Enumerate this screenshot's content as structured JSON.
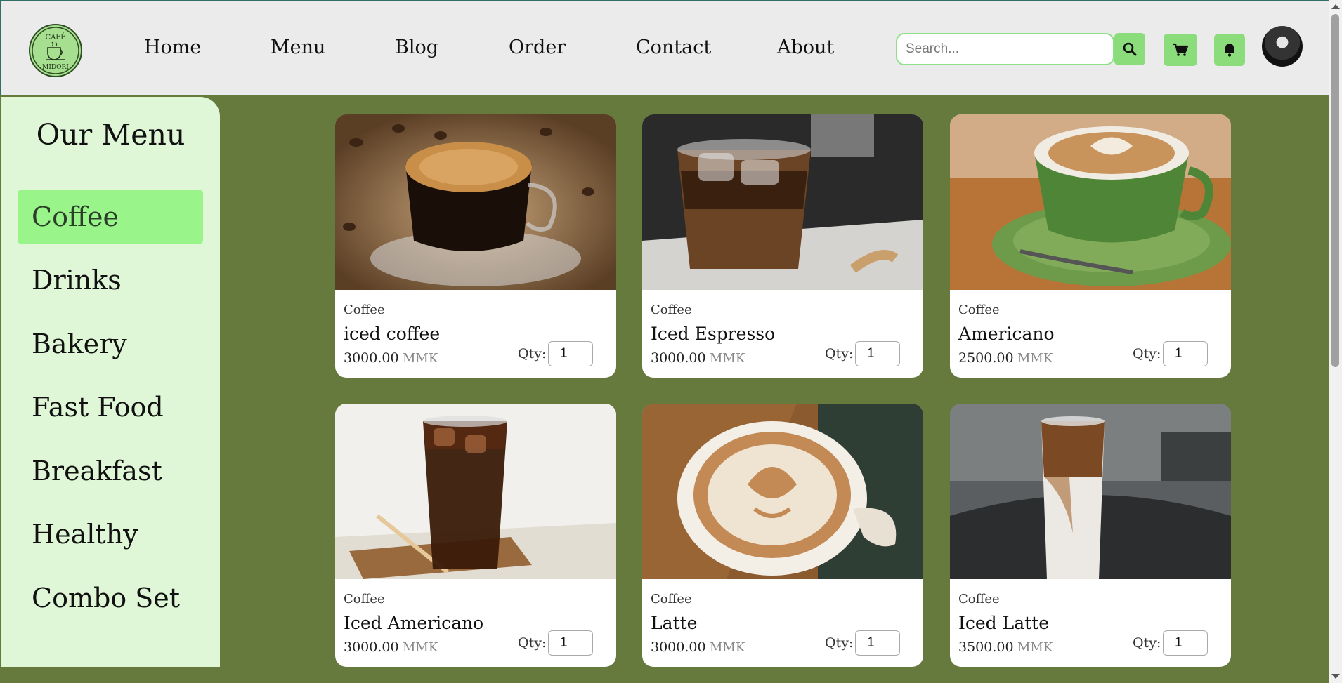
{
  "header": {
    "logo": {
      "top_text": "CAFÉ",
      "bottom_text": "MIDORI"
    },
    "nav": [
      {
        "label": "Home"
      },
      {
        "label": "Menu"
      },
      {
        "label": "Blog"
      },
      {
        "label": "Order"
      },
      {
        "label": "Contact"
      },
      {
        "label": "About"
      }
    ],
    "search": {
      "placeholder": "Search...",
      "value": ""
    },
    "icons": [
      "search-icon",
      "cart-icon",
      "bell-icon"
    ],
    "accent_color": "#8bdc7a"
  },
  "sidebar": {
    "title": "Our Menu",
    "active_index": 0,
    "categories": [
      {
        "label": "Coffee"
      },
      {
        "label": "Drinks"
      },
      {
        "label": "Bakery"
      },
      {
        "label": "Fast Food"
      },
      {
        "label": "Breakfast"
      },
      {
        "label": "Healthy"
      },
      {
        "label": "Combo Set"
      }
    ]
  },
  "products": [
    {
      "category": "Coffee",
      "name": "iced coffee",
      "price": "3000.00",
      "currency": "MMK",
      "qty_label": "Qty:",
      "qty": "1"
    },
    {
      "category": "Coffee",
      "name": "Iced Espresso",
      "price": "3000.00",
      "currency": "MMK",
      "qty_label": "Qty:",
      "qty": "1"
    },
    {
      "category": "Coffee",
      "name": "Americano",
      "price": "2500.00",
      "currency": "MMK",
      "qty_label": "Qty:",
      "qty": "1"
    },
    {
      "category": "Coffee",
      "name": "Iced Americano",
      "price": "3000.00",
      "currency": "MMK",
      "qty_label": "Qty:",
      "qty": "1"
    },
    {
      "category": "Coffee",
      "name": "Latte",
      "price": "3000.00",
      "currency": "MMK",
      "qty_label": "Qty:",
      "qty": "1"
    },
    {
      "category": "Coffee",
      "name": "Iced Latte",
      "price": "3500.00",
      "currency": "MMK",
      "qty_label": "Qty:",
      "qty": "1"
    }
  ],
  "colors": {
    "background": "#677a3d",
    "header_bg": "#ebebeb",
    "sidebar_bg": "#e0f7d7",
    "active_category": "#99f58a"
  }
}
